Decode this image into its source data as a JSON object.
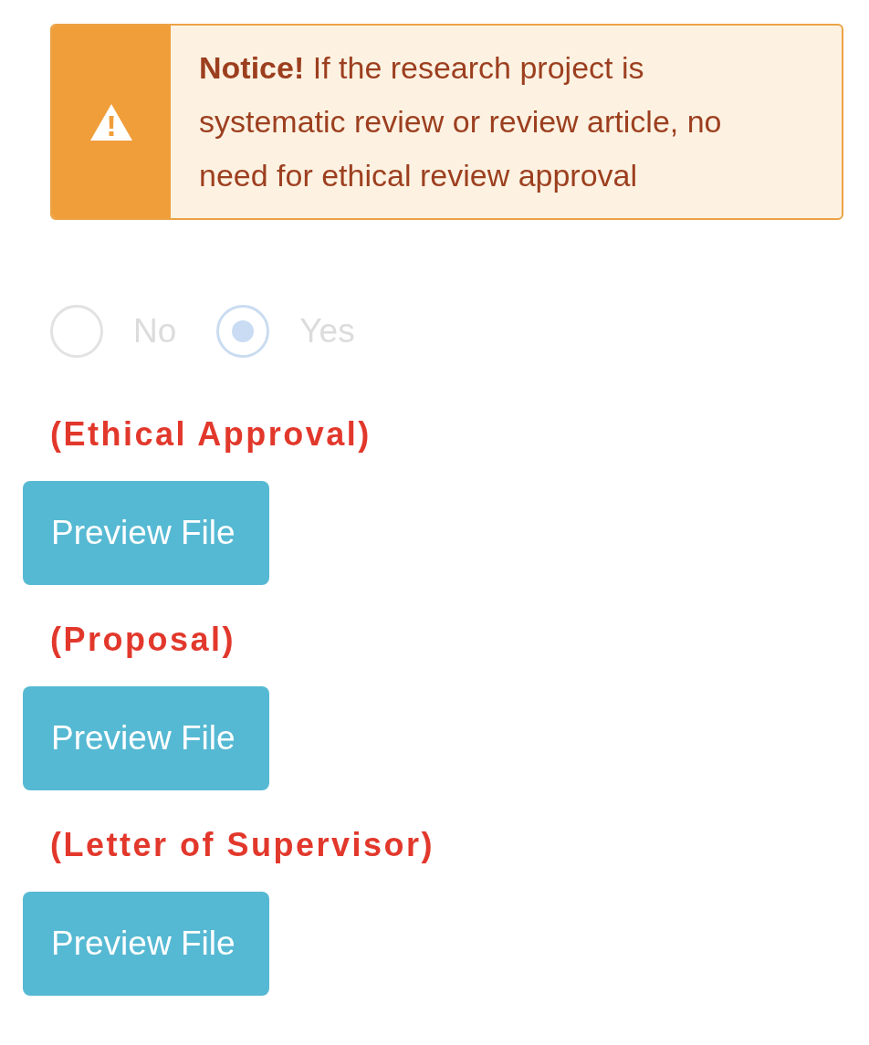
{
  "notice": {
    "text": "**Notice!** If the research project is systematic review or review article, no need for ethical review approval"
  },
  "radio_group": {
    "disabled": true,
    "options": [
      {
        "label": "No",
        "selected": false
      },
      {
        "label": "Yes",
        "selected": true
      }
    ]
  },
  "attachments": [
    {
      "label": "(Ethical Approval)",
      "button": "Preview File"
    },
    {
      "label": "(Proposal)",
      "button": "Preview File"
    },
    {
      "label": "(Letter of Supervisor)",
      "button": "Preview File"
    }
  ]
}
